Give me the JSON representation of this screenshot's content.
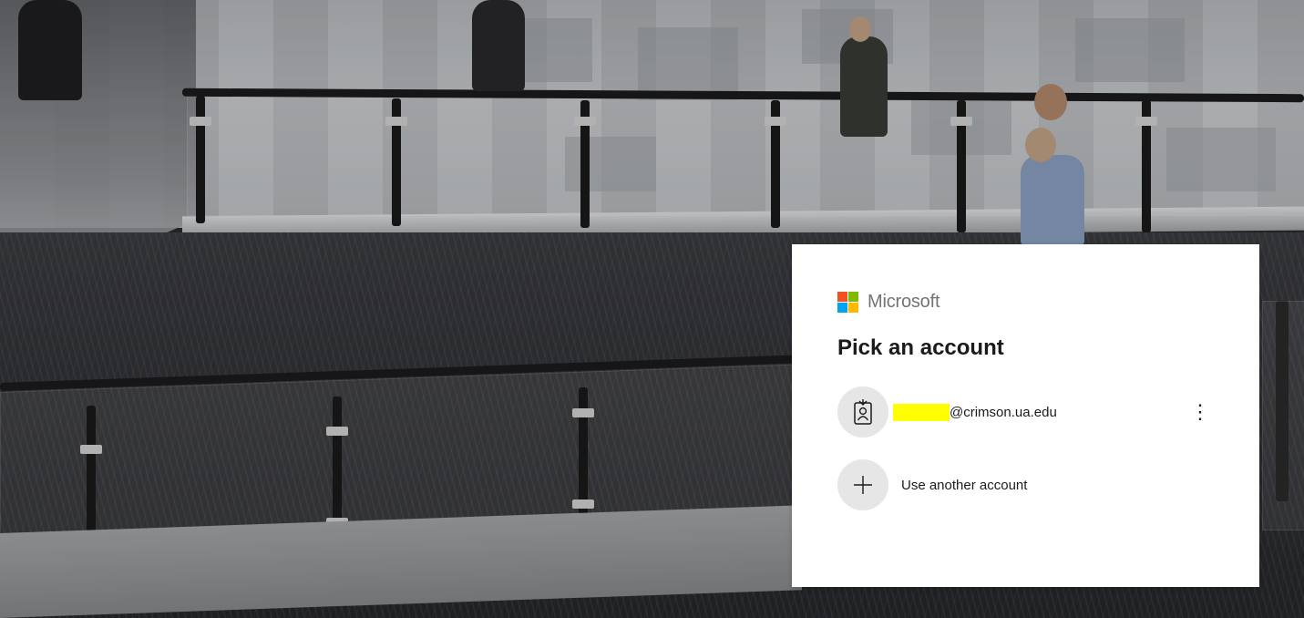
{
  "brand": {
    "name": "Microsoft",
    "logo_colors": [
      "#f25022",
      "#7fba00",
      "#00a4ef",
      "#ffb900"
    ]
  },
  "dialog": {
    "title": "Pick an account",
    "accounts": [
      {
        "email_visible": "@crimson.ua.edu",
        "redaction_color": "#ffff00",
        "avatar_icon": "work-badge-icon",
        "menu_icon": "more-options-icon",
        "menu_glyph": "⋮"
      }
    ],
    "use_another": {
      "label": "Use another account",
      "icon": "plus-icon"
    }
  },
  "background": {
    "description_icon": "office-atrium-photo"
  }
}
